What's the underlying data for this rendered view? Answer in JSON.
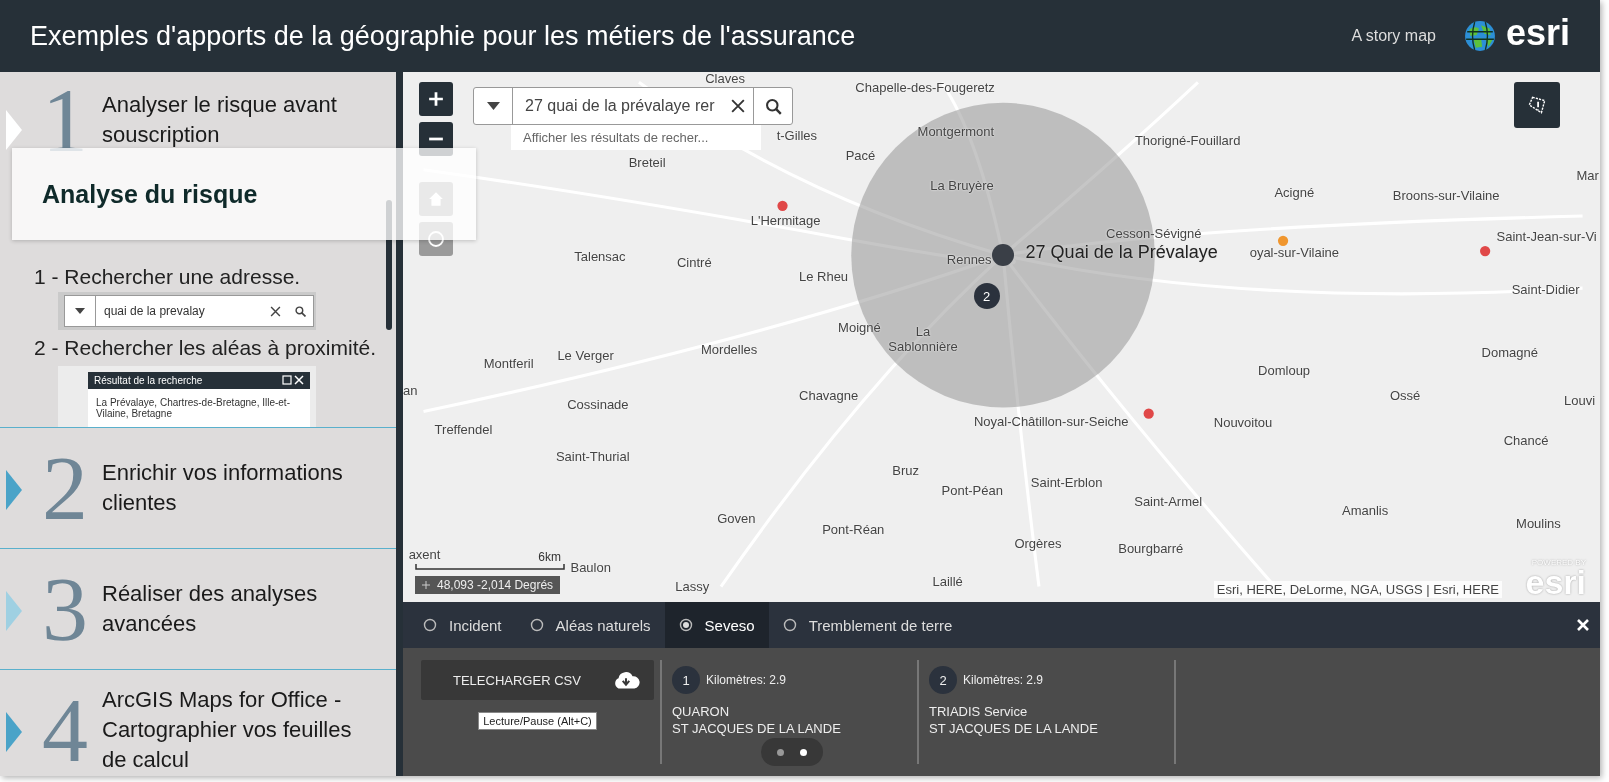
{
  "header": {
    "title": "Exemples d'apports de la géographie pour les métiers de l'assurance",
    "subtitle": "A story map",
    "logo_text": "esri"
  },
  "sections": [
    {
      "number": "1",
      "title": "Analyser le risque avant souscription",
      "selected": true,
      "hovered": false,
      "body": [
        {
          "kind": "text",
          "text": "1 - Rechercher une adresse."
        },
        {
          "kind": "search_image",
          "value": "quai de la prevalay"
        },
        {
          "kind": "text",
          "text": "2 - Rechercher les aléas à proximité."
        },
        {
          "kind": "popup_image",
          "title": "Résultat de la recherche",
          "text": "La Prévalaye, Chartres-de-Bretagne, Ille-et-Vilaine, Bretagne"
        }
      ]
    },
    {
      "number": "2",
      "title": "Enrichir vos informations clientes",
      "selected": false,
      "hovered": false
    },
    {
      "number": "3",
      "title": "Réaliser des analyses avancées",
      "selected": false,
      "hovered": true
    },
    {
      "number": "4",
      "title": "ArcGIS Maps for Office - Cartographier vos feuilles de calcul",
      "selected": false,
      "hovered": false
    }
  ],
  "overlay_card": {
    "title": "Analyse du risque"
  },
  "map": {
    "search": {
      "value": "27 quai de la prévalaye rer",
      "suggestion": "Afficher les résultats de recher..."
    },
    "labels": [
      "Claves",
      "Chapelle-des-Fougeretz",
      "Montgermont",
      "Thorigné-Fouillard",
      "t-Gilles",
      "Breteil",
      "Pacé",
      "La Bruyère",
      "Acigné",
      "Broons-sur-Vilaine",
      "Mar",
      "L'Hermitage",
      "Cesson-Sévigné",
      "Rennes",
      "Saint-Jean-sur-Vi",
      "Talensac",
      "Cintré",
      "oyal-sur-Vilaine",
      "Le Rheu",
      "Saint-Didier",
      "Moigné",
      "La",
      "Sablonnière",
      "Montferil",
      "Le Verger",
      "Mordelles",
      "Domloup",
      "Domagné",
      "Chavagne",
      "Cossinade",
      "Ossé",
      "Louvi",
      "an",
      "Treffendel",
      "Noyal-Châtillon-sur-Seiche",
      "Nouvoitou",
      "Chancé",
      "Saint-Thurial",
      "Bruz",
      "Saint-Erblon",
      "Pont-Péan",
      "Saint-Armel",
      "Amanlis",
      "Goven",
      "Pont-Réan",
      "Moulins",
      "Orgères",
      "Bourgbarré",
      "Baulon",
      "Lassy",
      "Laillé",
      "axent"
    ],
    "points": [
      {
        "color": "#e04848"
      },
      {
        "color": "#f0962e"
      },
      {
        "color": "#e04848"
      },
      {
        "color": "#e04848"
      }
    ],
    "address_marker": {
      "label": "27 Quai de la Prévalaye"
    },
    "result_markers": [
      {
        "number": "2"
      }
    ],
    "scale": {
      "label": "6km"
    },
    "coordinates": "48,093 -2,014 Degrés",
    "attribution": "Esri, HERE, DeLorme, NGA, USGS | Esri, HERE",
    "powered_by": {
      "caption": "POWERED BY",
      "logo_text": "esri"
    }
  },
  "results_panel": {
    "tabs": [
      {
        "label": "Incident",
        "selected": false
      },
      {
        "label": "Aléas naturels",
        "selected": false
      },
      {
        "label": "Seveso",
        "selected": true
      },
      {
        "label": "Tremblement de terre",
        "selected": false
      }
    ],
    "download_button": "TELECHARGER CSV",
    "tooltip": "Lecture/Pause (Alt+C)",
    "results": [
      {
        "number": "1",
        "distance": "Kilomètres: 2.9",
        "name": "QUARON",
        "city": "ST JACQUES DE LA LANDE"
      },
      {
        "number": "2",
        "distance": "Kilomètres: 2.9",
        "name": "TRIADIS Service",
        "city": "ST JACQUES DE LA LANDE"
      }
    ],
    "pager": [
      {
        "selected": false
      },
      {
        "selected": true
      }
    ]
  }
}
